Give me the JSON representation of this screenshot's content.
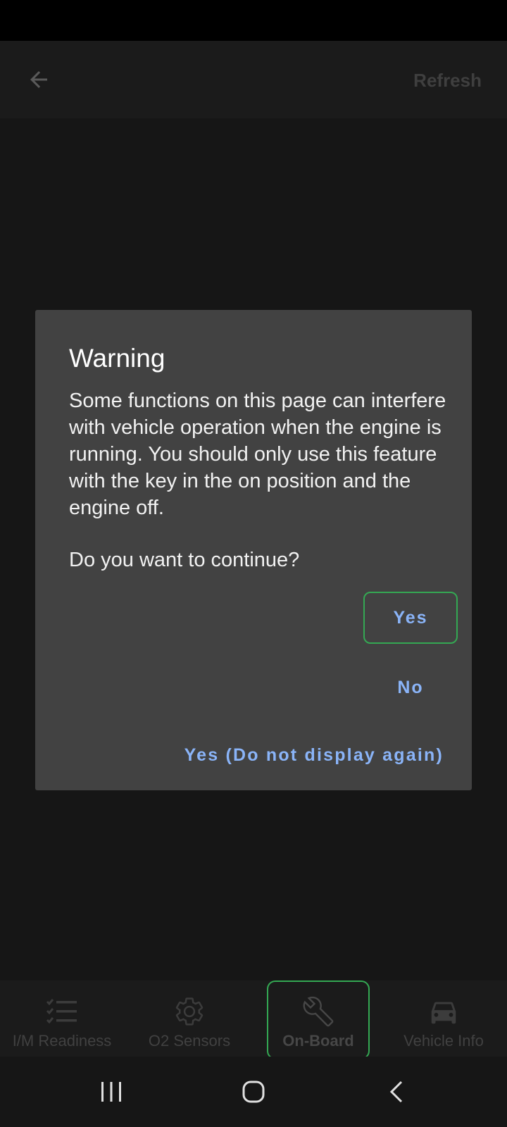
{
  "app_bar": {
    "back_icon": "arrow-left-icon",
    "refresh_label": "Refresh"
  },
  "dialog": {
    "title": "Warning",
    "message": "Some functions on this page can interfere with vehicle operation when the engine is running. You should only use this feature with the key in the on position and the engine off.",
    "question": "Do you want to continue?",
    "buttons": {
      "yes": "Yes",
      "no": "No",
      "yes_never": "Yes (Do not display again)"
    }
  },
  "bottom_nav": {
    "items": [
      {
        "label": "I/M Readiness",
        "icon": "checklist-icon"
      },
      {
        "label": "O2 Sensors",
        "icon": "gear-icon"
      },
      {
        "label": "On-Board",
        "icon": "wrench-icon",
        "selected": true
      },
      {
        "label": "Vehicle Info",
        "icon": "car-icon"
      }
    ]
  },
  "system_nav": {
    "recents_icon": "recents-icon",
    "home_icon": "home-icon",
    "back_icon": "back-chevron-icon"
  },
  "colors": {
    "dialog_bg": "#424242",
    "screen_bg": "#161616",
    "accent_button_text": "#8ab4f8",
    "focus_outline": "#34a853"
  }
}
